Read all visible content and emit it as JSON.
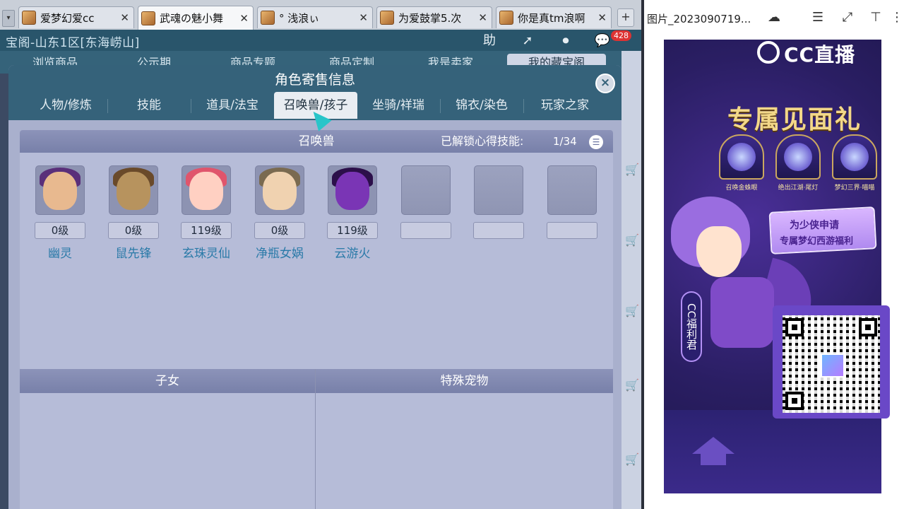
{
  "browser": {
    "tabs": [
      {
        "label": "爱梦幻爱cc"
      },
      {
        "label": "武魂の魅小舞"
      },
      {
        "label": "° 浅浪ぃ"
      },
      {
        "label": "为爱鼓掌5.次"
      },
      {
        "label": "你是真tm浪啊"
      }
    ],
    "add_tab": "+"
  },
  "game": {
    "location": "宝阁-山东1区[东海崂山]",
    "help": "助",
    "badge": "428",
    "nav_tabs": [
      "浏览商品",
      "公示期",
      "商品专题",
      "商品定制",
      "我是卖家",
      "我的藏宝阁"
    ]
  },
  "dialog": {
    "title": "角色寄售信息",
    "close": "×",
    "tabs": [
      "人物/修炼",
      "技能",
      "道具/法宝",
      "召唤兽/孩子",
      "坐骑/祥瑞",
      "锦衣/染色",
      "玩家之家"
    ],
    "pets_section": {
      "title": "召唤兽",
      "unlock_label": "已解锁心得技能:",
      "unlock_value": "1/34",
      "pets": [
        {
          "level": "0级",
          "name": "幽灵",
          "color": "#7b4a9a"
        },
        {
          "level": "0级",
          "name": "鼠先锋",
          "color": "#8a6a3a"
        },
        {
          "level": "119级",
          "name": "玄珠灵仙",
          "color": "#e86b7e"
        },
        {
          "level": "0级",
          "name": "净瓶女娲",
          "color": "#c9b07a"
        },
        {
          "level": "119级",
          "name": "云游火",
          "color": "#4a1f7a"
        }
      ],
      "empty_slots": 3
    },
    "children_section": {
      "title": "子女"
    },
    "special_pets_section": {
      "title": "特殊宠物"
    }
  },
  "viewer": {
    "title": "图片_2023090719...",
    "poster": {
      "logo": "CC直播",
      "heading": "专属见面礼",
      "gifts": [
        "召唤金蛛眼",
        "绝出江湖·尾灯",
        "梦幻三界·喵喵"
      ],
      "promo_line1": "为少侠申请",
      "promo_line2": "专属梦幻西游福利",
      "tag": "CC福利君"
    }
  }
}
